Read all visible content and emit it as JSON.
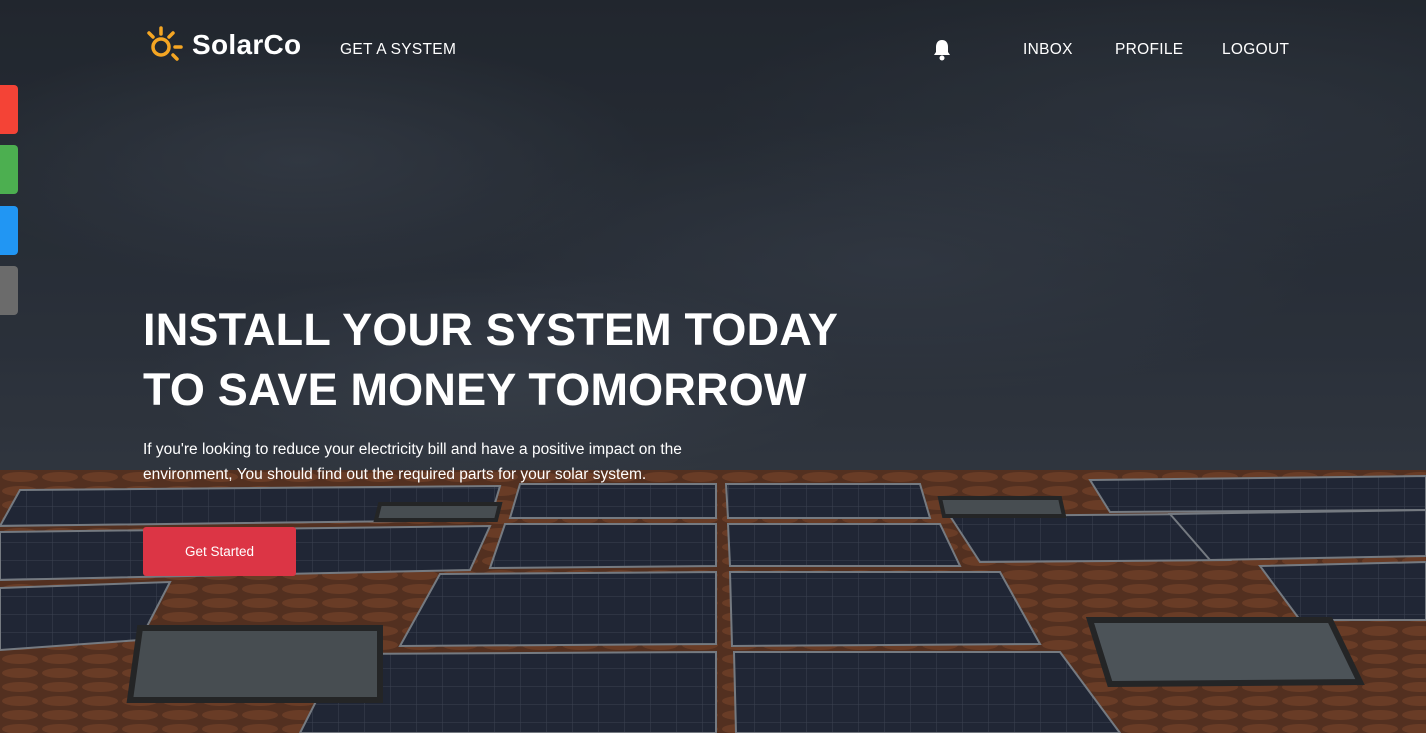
{
  "brand": {
    "name": "SolarCo",
    "accent_color": "#f5a623",
    "logo_icon": "sun-icon"
  },
  "nav": {
    "get_system": "GET A SYSTEM",
    "notifications_icon": "bell-icon",
    "inbox": "INBOX",
    "profile": "PROFILE",
    "logout": "LOGOUT"
  },
  "side_tabs": [
    {
      "color": "#f44336"
    },
    {
      "color": "#4caf50"
    },
    {
      "color": "#2196f3"
    },
    {
      "color": "#6b6b6b"
    }
  ],
  "hero": {
    "title_line1": "INSTALL YOUR SYSTEM TODAY",
    "title_line2": "TO SAVE MONEY TOMORROW",
    "description": "If you're looking to reduce your electricity bill and have a positive impact on the environment, You should find out the required parts for your solar system.",
    "cta_label": "Get Started",
    "cta_color": "#dc3545"
  }
}
